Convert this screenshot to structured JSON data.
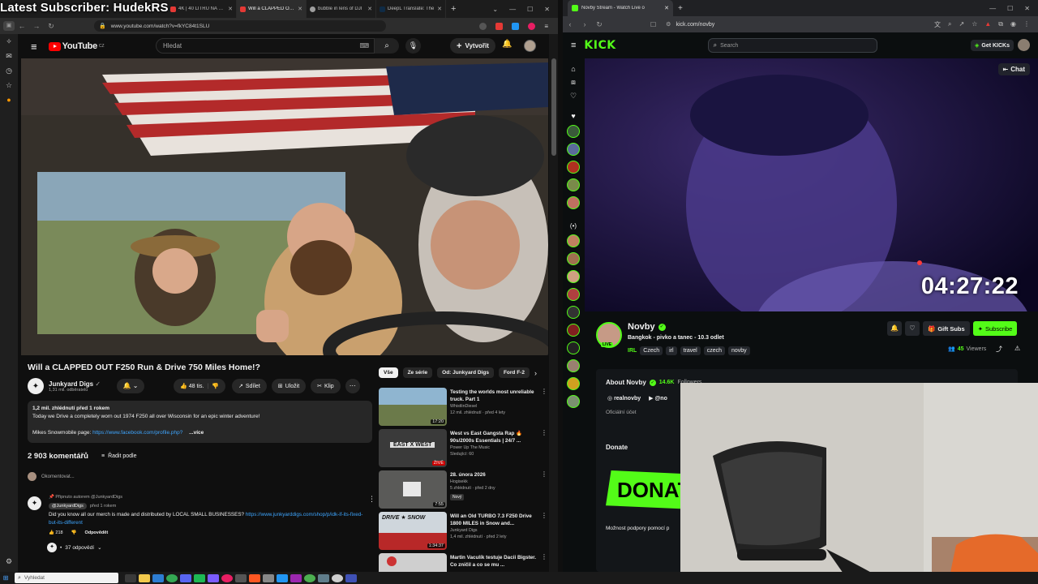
{
  "overlay": {
    "text": "Latest Subscriber: HudekRS"
  },
  "left_browser": {
    "tabs": [
      {
        "label": "4K | 40 LITRŮ NA STO",
        "color": "#e53935"
      },
      {
        "label": "Will a CLAPPED OUT",
        "color": "#e53935",
        "active": true
      },
      {
        "label": "bubble in lens of DJI",
        "color": "#9e9e9e"
      },
      {
        "label": "DeepL Translate: The",
        "color": "#0f2b46"
      }
    ],
    "url": "www.youtube.com/watch?v=fkYC84t1SLU"
  },
  "youtube": {
    "country": "CZ",
    "search_placeholder": "Hledat",
    "create_label": "Vytvořit",
    "video_title": "Will a CLAPPED OUT F250 Run & Drive 750 Miles Home!?",
    "channel_name": "Junkyard Digs",
    "channel_subs": "1,31 mil. odběratelů",
    "likes": "48 tis.",
    "share_label": "Sdílet",
    "save_label": "Uložit",
    "clip_label": "Klip",
    "desc_meta": "1,2 mil. zhlédnutí  před 1 rokem",
    "desc_line": "Today we Drive a completely worn out 1974 F250 all over Wisconsin for an epic winter adventure!",
    "desc_link_prefix": "Mikes Snowmobile page:",
    "desc_link": "https://www.facebook.com/profile.php?",
    "desc_more": "...více",
    "comments_count": "2 903 komentářů",
    "sort_label": "Řadit podle",
    "comment_placeholder": "Okomentovat...",
    "pinned_label": "Připnuto autorem @JunkyardDigs",
    "comment_author": "@JunkyardDigs",
    "comment_time": "před 1 rokem",
    "comment_text": "Did you know all our merch is made and distributed by LOCAL SMALL BUSINESSES?",
    "comment_link": "https://www.junkyarddigs.com/shop/p/idk-if-its-fixed-but-its-different",
    "comment_likes": "218",
    "reply_label": "Odpovědět",
    "replies_label": "37 odpovědí",
    "chips": [
      "Vše",
      "Ze série",
      "Od: Junkyard Digs",
      "Ford F-2"
    ],
    "recs": [
      {
        "title": "Testing the worlds most unreliable truck.  Part 1",
        "channel": "WhistlinDiesel",
        "meta": "12 mil. zhlédnutí · před 4 lety",
        "duration": "17:20",
        "badge": ""
      },
      {
        "title": "West vs East Gangsta Rap 🔥 90s/2000s Essentials | 24/7 ...",
        "channel": "Power Up The Music",
        "meta": "Sledující: 60",
        "duration": "ŽIVĚ",
        "badge": ""
      },
      {
        "title": "28. února 2026",
        "channel": "Hogisekk",
        "meta": "5 zhlédnutí · před 2 dny",
        "duration": "7:55",
        "badge": "Nový"
      },
      {
        "title": "Will an Old TURBO 7.3 F250 Drive 1800 MILES in Snow and...",
        "channel": "Junkyard Digs",
        "meta": "1,4 mil. zhlédnutí · před 2 lety",
        "duration": "1:34:37",
        "badge": ""
      },
      {
        "title": "Martin Vaculík testuje Dacii Bigster. Co zničil a co se mu ...",
        "channel": "",
        "meta": "",
        "duration": "",
        "badge": ""
      }
    ]
  },
  "right_browser": {
    "tab_label": "Novby Stream - Watch Live o",
    "url": "kick.com/novby"
  },
  "kick": {
    "logo": "KICK",
    "search_placeholder": "Search",
    "get_kicks": "Get KICKs",
    "chat_label": "Chat",
    "timer": "04:27:22",
    "streamer": "Novby",
    "stream_title": "Bangkok - pivko a tanec - 10.3 odlet",
    "category": "IRL",
    "tags": [
      "Czech",
      "irl",
      "travel",
      "czech",
      "novby"
    ],
    "live_badge": "LIVE",
    "gift_subs": "Gift Subs",
    "subscribe": "Subscribe",
    "viewers": "45",
    "viewers_label": "Viewers",
    "about_label": "About Novby",
    "followers": "14.6K",
    "followers_label": "Followers",
    "social_ig": "realnovby",
    "social_yt": "@no",
    "official": "Oficiální účet",
    "donate_heading": "Donate",
    "donate_banner": "DONAT",
    "donate_note": "Možnost podpory pomocí p"
  },
  "taskbar": {
    "search_placeholder": "Vyhledat"
  },
  "colors": {
    "kick_green": "#53fc18",
    "yt_red": "#ff0000",
    "link_blue": "#3ea6ff"
  }
}
